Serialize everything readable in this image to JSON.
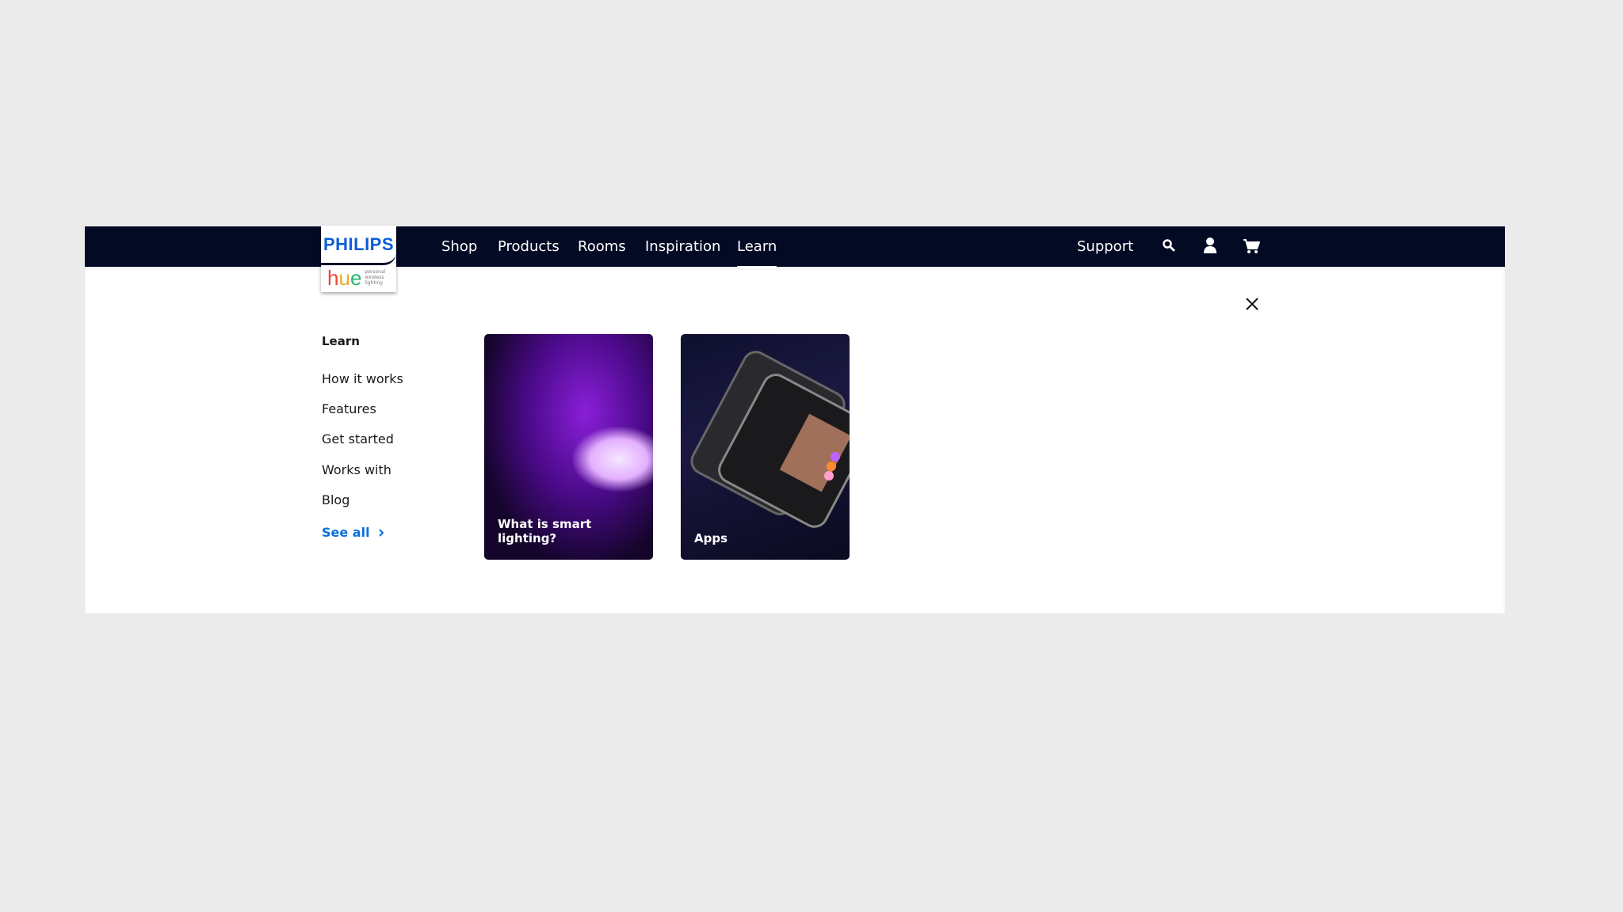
{
  "brand": {
    "name": "PHILIPS",
    "sub": "hue",
    "tagline": [
      "personal",
      "wireless",
      "lighting"
    ]
  },
  "nav": {
    "items": [
      "Shop",
      "Products",
      "Rooms",
      "Inspiration",
      "Learn"
    ],
    "active": "Learn",
    "support": "Support"
  },
  "icons": [
    "search-icon",
    "user-icon",
    "cart-icon",
    "close-icon",
    "chevron-right-icon"
  ],
  "menu": {
    "heading": "Learn",
    "items": [
      "How it works",
      "Features",
      "Get started",
      "Works with",
      "Blog"
    ],
    "see_all": "See all"
  },
  "cards": [
    {
      "label": "What is smart lighting?"
    },
    {
      "label": "Apps"
    }
  ],
  "colors": {
    "navbar": "#020a24",
    "link": "#0b6fe0",
    "brand_blue": "#0b5ed7"
  }
}
